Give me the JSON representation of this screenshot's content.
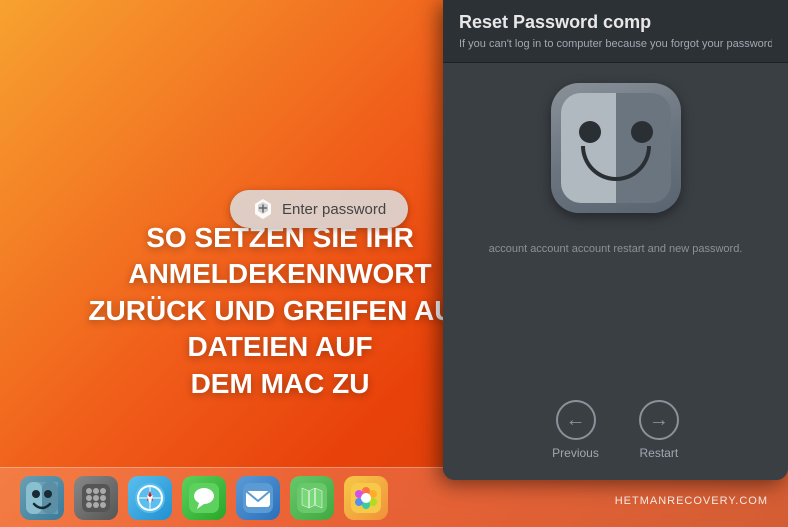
{
  "desktop": {
    "bg_color_start": "#f7a230",
    "bg_color_end": "#c93a08"
  },
  "overlay": {
    "title_line1": "SO SETZEN SIE IHR ANMELDEKENNWORT",
    "title_line2": "ZURÜCK UND GREIFEN AUF DATEIEN AUF",
    "title_line3": "DEM MAC ZU"
  },
  "dialog": {
    "title": "Reset Password comp",
    "subtitle": "If you can't log in to computer because you forgot your password, yo",
    "finder_icon_alt": "Finder face icon",
    "enter_password_label": "Enter password",
    "info_text": "account account account restart and new password.",
    "btn_previous_label": "Previous",
    "btn_restart_label": "Restart"
  },
  "dock": {
    "icons": [
      {
        "name": "Finder",
        "class": "finder-dock",
        "emoji": "🖥"
      },
      {
        "name": "Launchpad",
        "class": "launchpad-dock",
        "emoji": "⬛"
      },
      {
        "name": "Safari",
        "class": "safari-dock",
        "emoji": "🌐"
      },
      {
        "name": "Messages",
        "class": "messages-dock",
        "emoji": "💬"
      },
      {
        "name": "Mail",
        "class": "mail-dock",
        "emoji": "✉"
      },
      {
        "name": "Maps",
        "class": "maps-dock",
        "emoji": "🗺"
      },
      {
        "name": "Photos",
        "class": "photos-dock",
        "emoji": "🌸"
      }
    ]
  },
  "website": {
    "url": "HETMANRECOVERY.COM"
  }
}
